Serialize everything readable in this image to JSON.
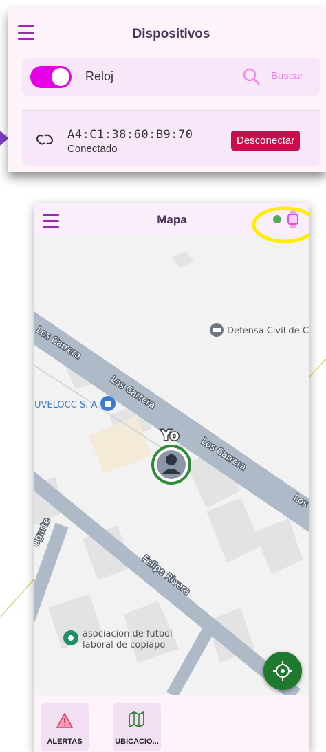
{
  "devices_screen": {
    "title": "Dispositivos",
    "toggle_label": "Reloj",
    "search_label": "Buscar",
    "device": {
      "id": "A4:C1:38:60:B9:70",
      "status": "Conectado",
      "action": "Desconectar"
    }
  },
  "map_screen": {
    "title": "Mapa",
    "user_marker_label": "Yo",
    "streets": [
      "Los Carrera",
      "Los Carrera",
      "Los Carrera",
      "Los Carrera",
      "Los",
      "Felipe Rivera",
      "Ugarte"
    ],
    "pois": [
      "Defensa Civil de Ch",
      "UVELOCC S. A",
      "asociacion de futbol",
      "laboral de copiapo"
    ],
    "nav": [
      {
        "label": "ALERTAS"
      },
      {
        "label": "UBICACIO..."
      }
    ]
  },
  "colors": {
    "accent": "#e700e5",
    "menu": "#9c27b0",
    "danger": "#cc0d4b",
    "status_dot": "#4caf50",
    "highlight": "#ffee00"
  }
}
